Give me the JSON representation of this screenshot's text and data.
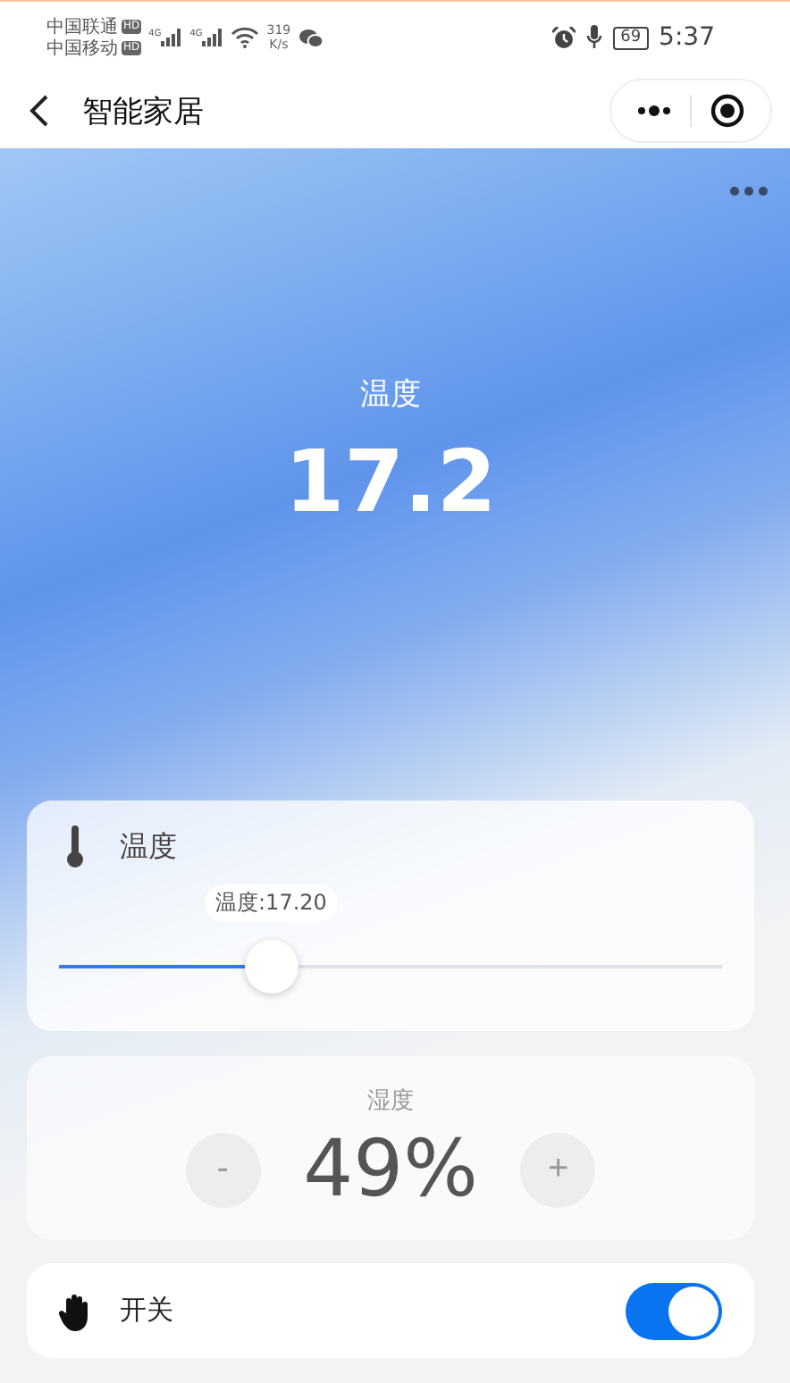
{
  "status_bar": {
    "carriers": [
      {
        "name": "中国联通",
        "badge": "HD"
      },
      {
        "name": "中国移动",
        "badge": "HD"
      }
    ],
    "signals": [
      {
        "network": "4G"
      },
      {
        "network": "4G"
      }
    ],
    "speed": "319",
    "speed_unit": "K/s",
    "battery": "69",
    "time": "5:37"
  },
  "header": {
    "title": "智能家居"
  },
  "hero": {
    "label": "温度",
    "value": "17.2"
  },
  "temperature_card": {
    "title": "温度",
    "tooltip": "温度:17.20",
    "level": 0.32
  },
  "humidity_card": {
    "label": "湿度",
    "value": "49%",
    "minus": "-",
    "plus": "+"
  },
  "switch_card": {
    "label": "开关",
    "on": true
  }
}
